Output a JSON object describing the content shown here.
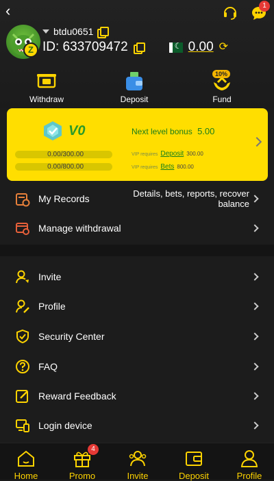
{
  "header": {
    "username": "btdu0651",
    "user_id": "ID: 633709472",
    "balance": "0.00",
    "message_badge": "1"
  },
  "quick_actions": {
    "withdraw": "Withdraw",
    "deposit": "Deposit",
    "fund": "Fund",
    "fund_badge": "10%"
  },
  "vip": {
    "level": "V0",
    "next_level_bonus_label": "Next level bonus",
    "next_level_bonus_value": "5.00",
    "deposit_progress": "0.00/300.00",
    "bets_progress": "0.00/800.00",
    "req_label": "VIP requires",
    "deposit_link": "Deposit",
    "deposit_req": "300.00",
    "bets_link": "Bets",
    "bets_req": "800.00"
  },
  "menu_top": [
    {
      "label": "My Records",
      "desc_line1": "Details, bets, reports, recover",
      "desc_line2": "balance"
    },
    {
      "label": "Manage withdrawal"
    }
  ],
  "menu": [
    {
      "label": "Invite"
    },
    {
      "label": "Profile"
    },
    {
      "label": "Security Center"
    },
    {
      "label": "FAQ"
    },
    {
      "label": "Reward Feedback"
    },
    {
      "label": "Login device"
    }
  ],
  "bottom_nav": {
    "home": "Home",
    "promo": "Promo",
    "promo_badge": "4",
    "invite": "Invite",
    "deposit": "Deposit",
    "profile": "Profile"
  },
  "colors": {
    "accent": "#ffd400",
    "vip_card": "#ffde00",
    "vip_text": "#2b9a28",
    "badge": "#e53935"
  }
}
